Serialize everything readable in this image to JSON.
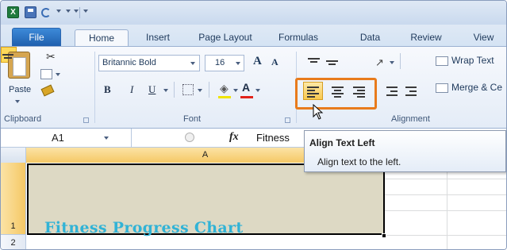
{
  "qat": {
    "app_logo": "X"
  },
  "tabs": [
    {
      "label": "File"
    },
    {
      "label": "Home"
    },
    {
      "label": "Insert"
    },
    {
      "label": "Page Layout"
    },
    {
      "label": "Formulas"
    },
    {
      "label": "Data"
    },
    {
      "label": "Review"
    },
    {
      "label": "View"
    }
  ],
  "ribbon": {
    "clipboard": {
      "paste_label": "Paste",
      "group_label": "Clipboard"
    },
    "font": {
      "font_name": "Britannic Bold",
      "font_size": "16",
      "grow_label": "A",
      "shrink_label": "A",
      "bold_label": "B",
      "italic_label": "I",
      "underline_label": "U",
      "font_color_label": "A",
      "group_label": "Font",
      "fill_color": "#f0e400",
      "font_color": "#e2231a"
    },
    "alignment": {
      "wrap_text_label": "Wrap Text",
      "merge_label": "Merge & Ce",
      "group_label": "Alignment",
      "highlight_color": "#e87b1c"
    }
  },
  "formula_bar": {
    "name_box": "A1",
    "fx_label": "fx",
    "value": "Fitness"
  },
  "sheet": {
    "column_headers": [
      "A"
    ],
    "row_headers": [
      "1",
      "2"
    ],
    "cell_a1_value": "Fitness Progress Chart",
    "cell_a1_fill": "#ddd9c4",
    "cell_a1_text_color": "#31b3d6"
  },
  "tooltip": {
    "title": "Align Text Left",
    "description": "Align text to the left."
  }
}
